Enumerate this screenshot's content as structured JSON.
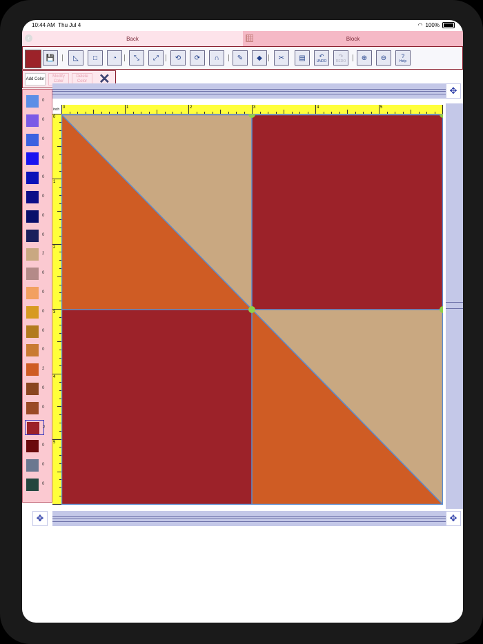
{
  "status": {
    "time": "10:44 AM",
    "date": "Thu Jul 4",
    "battery": "100%"
  },
  "nav": {
    "back_label": "Back",
    "block_label": "Block"
  },
  "toolbar": {
    "current_color": "#9c2229",
    "buttons": [
      {
        "name": "save-icon",
        "glyph": "💾"
      },
      {
        "name": "triangle-tool-icon",
        "glyph": "◺"
      },
      {
        "name": "square-tool-icon",
        "glyph": "□"
      },
      {
        "name": "curve-tool-icon",
        "glyph": "◔"
      },
      {
        "name": "resize-icon",
        "glyph": "⤡"
      },
      {
        "name": "shrink-icon",
        "glyph": "⤢"
      },
      {
        "name": "rotate-icon",
        "glyph": "⟲"
      },
      {
        "name": "flip-icon",
        "glyph": "⟳"
      },
      {
        "name": "magnet-icon",
        "glyph": "∩"
      },
      {
        "name": "eyedropper-icon",
        "glyph": "✎"
      },
      {
        "name": "paint-bucket-icon",
        "glyph": "◆"
      },
      {
        "name": "scissors-icon",
        "glyph": "✂"
      },
      {
        "name": "paste-icon",
        "glyph": "▤"
      },
      {
        "name": "undo-icon",
        "glyph": "↶"
      },
      {
        "name": "redo-icon",
        "glyph": "↷"
      },
      {
        "name": "zoom-in-icon",
        "glyph": "⊕"
      },
      {
        "name": "zoom-out-icon",
        "glyph": "⊖"
      },
      {
        "name": "help-icon",
        "glyph": "?"
      }
    ],
    "undo_label": "UNDO",
    "redo_label": "REDO",
    "help_label": "Help"
  },
  "color_buttons": {
    "add": "Add Color",
    "modify": "Modify Color",
    "delete": "Delete Color"
  },
  "palette": [
    {
      "color": "#5b8ee6",
      "count": "0"
    },
    {
      "color": "#7b5ae6",
      "count": "0"
    },
    {
      "color": "#3c62e0",
      "count": "0"
    },
    {
      "color": "#1a14f0",
      "count": "0"
    },
    {
      "color": "#0c12b8",
      "count": "0"
    },
    {
      "color": "#0c0e88",
      "count": "0"
    },
    {
      "color": "#0a0f6a",
      "count": "0"
    },
    {
      "color": "#1b1f5c",
      "count": "0"
    },
    {
      "color": "#c9a881",
      "count": "2"
    },
    {
      "color": "#b48a88",
      "count": "0"
    },
    {
      "color": "#f2a060",
      "count": "0"
    },
    {
      "color": "#d79a22",
      "count": "0"
    },
    {
      "color": "#b27a1e",
      "count": "0"
    },
    {
      "color": "#c97a32",
      "count": "0"
    },
    {
      "color": "#cf5c24",
      "count": "2"
    },
    {
      "color": "#8a4520",
      "count": "0"
    },
    {
      "color": "#9a4a26",
      "count": "0"
    },
    {
      "color": "#9c2229",
      "count": "2",
      "selected": true
    },
    {
      "color": "#6a0a0c",
      "count": "0"
    },
    {
      "color": "#6b7890",
      "count": "0"
    },
    {
      "color": "#23463e",
      "count": "0"
    }
  ],
  "ruler": {
    "unit_label": "inch",
    "top_numbers": [
      "0",
      "1",
      "2",
      "3",
      "4",
      "5"
    ],
    "left_numbers": [
      "0",
      "1",
      "2",
      "3",
      "4",
      "5"
    ]
  },
  "block": {
    "colors": {
      "tan": "#c9a881",
      "orange": "#cf5c24",
      "red": "#9c2229",
      "seam": "#5b8ccf",
      "node": "#8fd04a"
    }
  }
}
